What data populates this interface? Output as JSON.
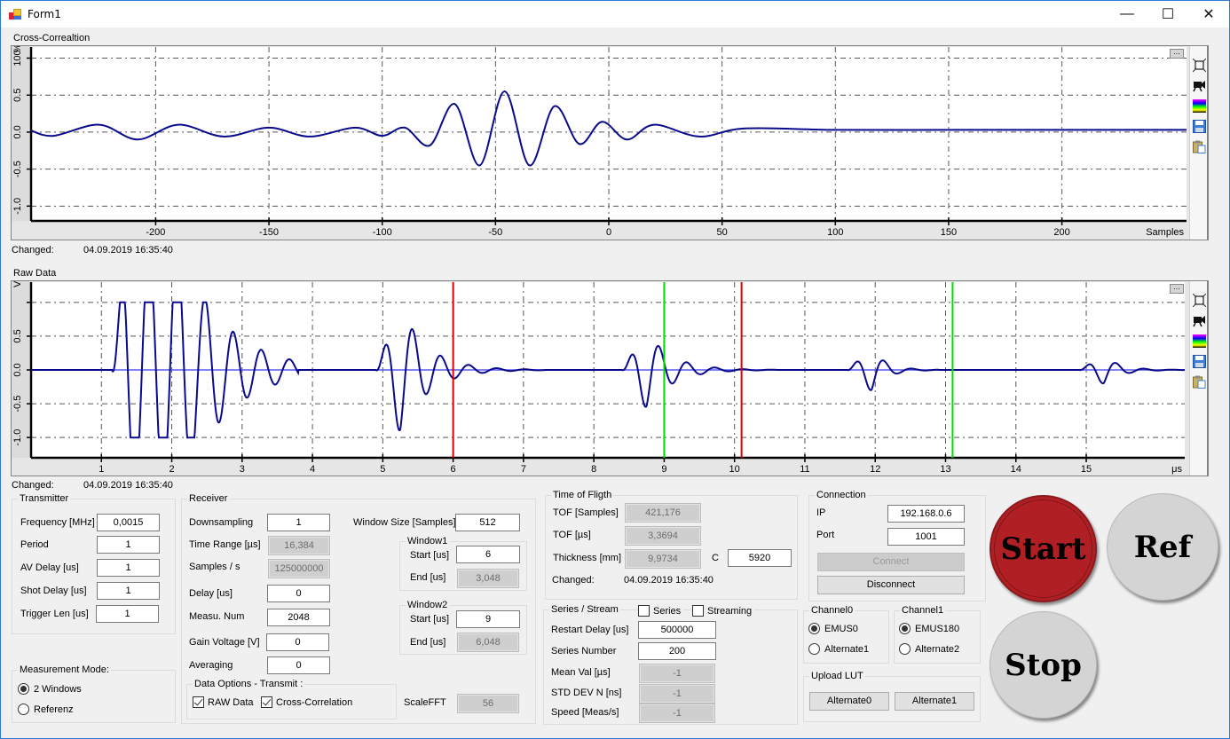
{
  "window": {
    "title": "Form1",
    "controls": {
      "minimize": "—",
      "maximize": "☐",
      "close": "✕"
    }
  },
  "cross_correlation": {
    "title": "Cross-Correaltion",
    "changed_label": "Changed:",
    "changed_value": "04.09.2019 16:35:40",
    "toolbar_icons": [
      "fit-icon",
      "camera-icon",
      "palette-icon",
      "save-icon",
      "clipboard-icon"
    ]
  },
  "raw_data": {
    "title": "Raw Data",
    "changed_label": "Changed:",
    "changed_value": "04.09.2019 16:35:40",
    "toolbar_icons": [
      "fit-icon",
      "camera-icon",
      "palette-icon",
      "save-icon",
      "clipboard-icon"
    ]
  },
  "chart_data": [
    {
      "type": "line",
      "title": "Cross-Correaltion",
      "xlabel": "Samples",
      "ylabel": "%",
      "xlim": [
        -255,
        255
      ],
      "ylim": [
        -1.2,
        1.15
      ],
      "x_ticks": [
        -200,
        -150,
        -100,
        -50,
        0,
        50,
        100,
        150,
        200
      ],
      "y_ticks": [
        {
          "v": 1.0,
          "label": "100"
        },
        {
          "v": 0.5,
          "label": "0.5"
        },
        {
          "v": 0.0,
          "label": "0.0"
        },
        {
          "v": -0.5,
          "label": "-0.5"
        },
        {
          "v": -1.0,
          "label": "-1.0"
        }
      ],
      "grid": true,
      "series": [
        {
          "name": "cross-correlation",
          "color": "#0a0a8c",
          "description": "oscillating correlation, peak 0.55 near -46 samples, adjacent lobes -0.45 at -57 and -35, 0.38 at -68 and 0.35 at -24",
          "key_points": [
            [
              -255,
              0.02
            ],
            [
              -245,
              -0.05
            ],
            [
              -225,
              0.1
            ],
            [
              -208,
              -0.1
            ],
            [
              -190,
              0.1
            ],
            [
              -170,
              -0.06
            ],
            [
              -150,
              0.06
            ],
            [
              -132,
              -0.06
            ],
            [
              -112,
              0.06
            ],
            [
              -100,
              -0.05
            ],
            [
              -90,
              0.06
            ],
            [
              -79,
              -0.18
            ],
            [
              -68,
              0.38
            ],
            [
              -57,
              -0.45
            ],
            [
              -46,
              0.55
            ],
            [
              -35,
              -0.45
            ],
            [
              -24,
              0.35
            ],
            [
              -13,
              -0.16
            ],
            [
              -3,
              0.14
            ],
            [
              8,
              -0.1
            ],
            [
              20,
              0.1
            ],
            [
              40,
              -0.06
            ],
            [
              60,
              0.05
            ],
            [
              100,
              0.03
            ],
            [
              150,
              0.03
            ],
            [
              200,
              0.03
            ],
            [
              255,
              0.03
            ]
          ]
        }
      ]
    },
    {
      "type": "line",
      "title": "Raw Data",
      "xlabel": "μs",
      "ylabel": "V",
      "xlim": [
        0,
        16.4
      ],
      "ylim": [
        -1.3,
        1.3
      ],
      "x_ticks": [
        1,
        2,
        3,
        4,
        5,
        6,
        7,
        8,
        9,
        10,
        11,
        12,
        13,
        14,
        15
      ],
      "y_ticks": [
        {
          "v": 1.0,
          "label": ""
        },
        {
          "v": 0.5,
          "label": "0.5"
        },
        {
          "v": 0.0,
          "label": "0.0"
        },
        {
          "v": -0.5,
          "label": "-0.5"
        },
        {
          "v": -1.0,
          "label": "-1.0"
        }
      ],
      "grid": true,
      "series": [
        {
          "name": "raw-signal",
          "color": "#0a0a8c",
          "bursts": [
            {
              "start": 1.15,
              "end": 3.8,
              "peak": 1.0,
              "saturated": true
            },
            {
              "start": 4.9,
              "end": 7.3,
              "peak": 0.9
            },
            {
              "start": 8.4,
              "end": 10.6,
              "peak": 0.55
            },
            {
              "start": 11.6,
              "end": 12.9,
              "peak": 0.3
            },
            {
              "start": 14.9,
              "end": 16.4,
              "peak": 0.2
            }
          ]
        },
        {
          "name": "baseline",
          "color": "#5a5af0",
          "value": 0.0
        }
      ],
      "markers": [
        {
          "name": "window1-start",
          "x": 6.0,
          "color": "#e00000"
        },
        {
          "name": "window1-end",
          "x": 10.1,
          "color": "#e00000"
        },
        {
          "name": "window2-start",
          "x": 9.0,
          "color": "#00dd00"
        },
        {
          "name": "window2-end",
          "x": 13.1,
          "color": "#00dd00"
        }
      ]
    }
  ],
  "transmitter": {
    "title": "Transmitter",
    "fields": [
      {
        "label": "Frequency [MHz]",
        "value": "0,0015"
      },
      {
        "label": "Period",
        "value": "1"
      },
      {
        "label": "AV Delay [us]",
        "value": "1"
      },
      {
        "label": "Shot Delay [us]",
        "value": "1"
      },
      {
        "label": "Trigger Len [us]",
        "value": "1"
      }
    ]
  },
  "measurement_mode": {
    "title": "Measurement Mode:",
    "options": [
      {
        "label": "2 Windows",
        "selected": true
      },
      {
        "label": "Referenz",
        "selected": false
      }
    ]
  },
  "receiver": {
    "title": "Receiver",
    "fields": [
      {
        "label": "Downsampling",
        "value": "1",
        "readonly": false
      },
      {
        "label": "Time Range [µs]",
        "value": "16,384",
        "readonly": true
      },
      {
        "label": "Samples / s",
        "value": "125000000",
        "readonly": true
      },
      {
        "label": "Delay [us]",
        "value": "0",
        "readonly": false
      },
      {
        "label": "Measu. Num",
        "value": "2048",
        "readonly": false
      },
      {
        "label": "Gain Voltage [V]",
        "value": "0",
        "readonly": false
      },
      {
        "label": "Averaging",
        "value": "0",
        "readonly": false
      }
    ],
    "window_size_label": "Window Size [Samples]",
    "window_size_value": "512",
    "window1": {
      "title": "Window1",
      "start_label": "Start [us]",
      "start_value": "6",
      "end_label": "End [us]",
      "end_value": "3,048"
    },
    "window2": {
      "title": "Window2",
      "start_label": "Start [us]",
      "start_value": "9",
      "end_label": "End [us]",
      "end_value": "6,048"
    },
    "data_options": {
      "title": "Data Options - Transmit :",
      "raw_label": "RAW Data",
      "raw_checked": true,
      "cc_label": "Cross-Correlation",
      "cc_checked": true
    },
    "scale_fft_label": "ScaleFFT",
    "scale_fft_value": "56"
  },
  "time_of_flight": {
    "title": "Time of Fligth",
    "tof_samples_label": "TOF [Samples]",
    "tof_samples_value": "421,176",
    "tof_us_label": "TOF [µs]",
    "tof_us_value": "3,3694",
    "thickness_label": "Thickness [mm]",
    "thickness_value": "9,9734",
    "c_label": "C",
    "c_value": "5920",
    "changed_label": "Changed:",
    "changed_value": "04.09.2019 16:35:40"
  },
  "series_stream": {
    "title": "Series / Stream",
    "series_label": "Series",
    "series_checked": false,
    "streaming_label": "Streaming",
    "streaming_checked": false,
    "fields": [
      {
        "label": "Restart Delay [us]",
        "value": "500000",
        "readonly": false
      },
      {
        "label": "Series Number",
        "value": "200",
        "readonly": false
      },
      {
        "label": "Mean Val [µs]",
        "value": "-1",
        "readonly": true
      },
      {
        "label": "STD DEV N [ns]",
        "value": "-1",
        "readonly": true
      },
      {
        "label": "Speed [Meas/s]",
        "value": "-1",
        "readonly": true
      }
    ]
  },
  "connection": {
    "title": "Connection",
    "ip_label": "IP",
    "ip_value": "192.168.0.6",
    "port_label": "Port",
    "port_value": "1001",
    "connect_label": "Connect",
    "disconnect_label": "Disconnect"
  },
  "channel0": {
    "title": "Channel0",
    "options": [
      {
        "label": "EMUS0",
        "selected": true
      },
      {
        "label": "Alternate1",
        "selected": false
      }
    ]
  },
  "channel1": {
    "title": "Channel1",
    "options": [
      {
        "label": "EMUS180",
        "selected": true
      },
      {
        "label": "Alternate2",
        "selected": false
      }
    ]
  },
  "upload_lut": {
    "title": "Upload LUT",
    "button0": "Alternate0",
    "button1": "Alternate1"
  },
  "actions": {
    "start_label": "Start",
    "ref_label": "Ref",
    "stop_label": "Stop",
    "start_color": "#b01f24",
    "grey_color": "#d4d4d4"
  }
}
